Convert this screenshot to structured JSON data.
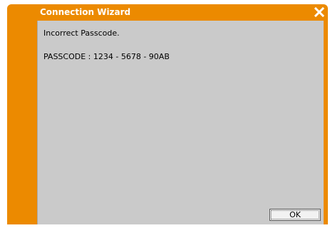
{
  "window": {
    "title": "Connection Wizard",
    "close_icon": "close-x-icon"
  },
  "content": {
    "message": "Incorrect Passcode.",
    "passcode": "PASSCODE : 1234 - 5678 - 90AB"
  },
  "buttons": {
    "ok_label": "OK"
  },
  "colors": {
    "accent": "#ec8a00",
    "panel": "#cacaca"
  }
}
